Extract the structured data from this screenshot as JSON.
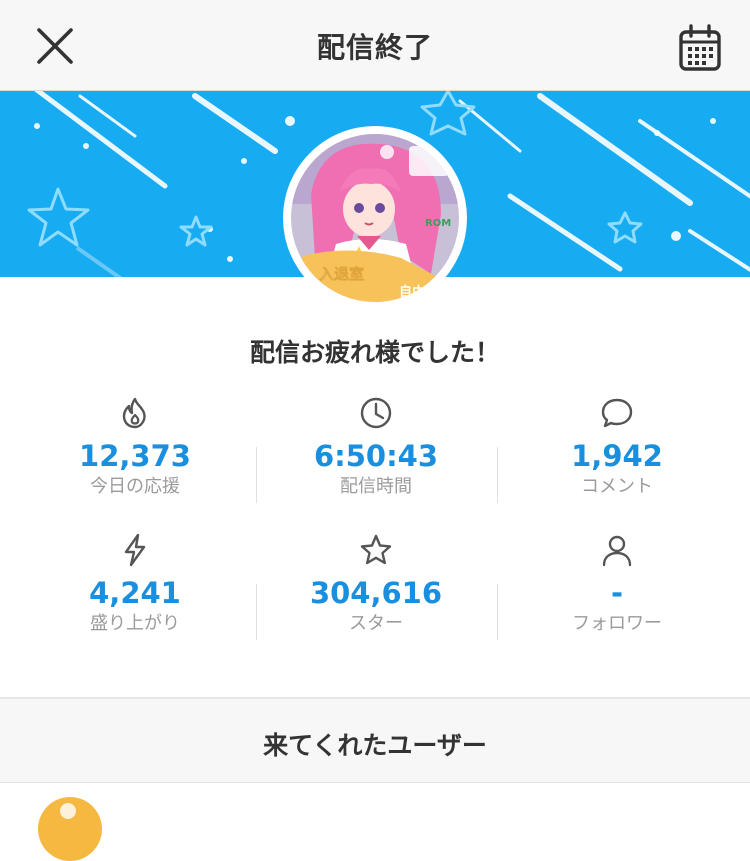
{
  "header": {
    "title": "配信終了",
    "close_icon": "close-icon",
    "calendar_icon": "calendar-icon"
  },
  "avatar": {
    "overlay_texts": [
      "入退室",
      "自由",
      "ROM"
    ]
  },
  "summary": {
    "message": "配信お疲れ様でした！"
  },
  "stats": [
    {
      "icon": "flame-icon",
      "value": "12,373",
      "label": "今日の応援"
    },
    {
      "icon": "clock-icon",
      "value": "6:50:43",
      "label": "配信時間"
    },
    {
      "icon": "speech-bubble-icon",
      "value": "1,942",
      "label": "コメント"
    },
    {
      "icon": "lightning-icon",
      "value": "4,241",
      "label": "盛り上がり"
    },
    {
      "icon": "star-icon",
      "value": "304,616",
      "label": "スター"
    },
    {
      "icon": "person-icon",
      "value": "-",
      "label": "フォロワー"
    }
  ],
  "users_section": {
    "title": "来てくれたユーザー"
  },
  "colors": {
    "banner": "#17abf2",
    "accent_value": "#1a8fe0",
    "label_gray": "#9b9b9b",
    "header_bg": "#f7f7f7"
  }
}
